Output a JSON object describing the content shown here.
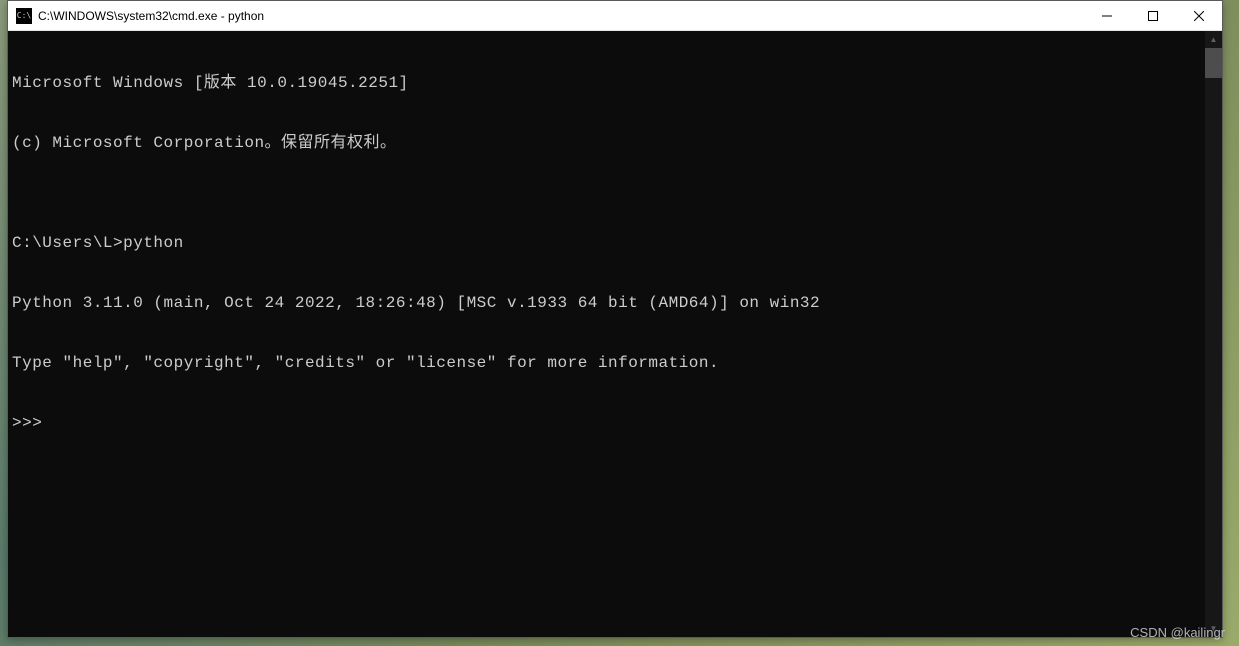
{
  "window": {
    "icon_label": "C:\\",
    "title": "C:\\WINDOWS\\system32\\cmd.exe - python"
  },
  "terminal": {
    "lines": [
      "Microsoft Windows [版本 10.0.19045.2251]",
      "(c) Microsoft Corporation。保留所有权利。",
      "",
      "C:\\Users\\L>python",
      "Python 3.11.0 (main, Oct 24 2022, 18:26:48) [MSC v.1933 64 bit (AMD64)] on win32",
      "Type \"help\", \"copyright\", \"credits\" or \"license\" for more information.",
      ">>>"
    ]
  },
  "watermark": "CSDN @kailingr"
}
